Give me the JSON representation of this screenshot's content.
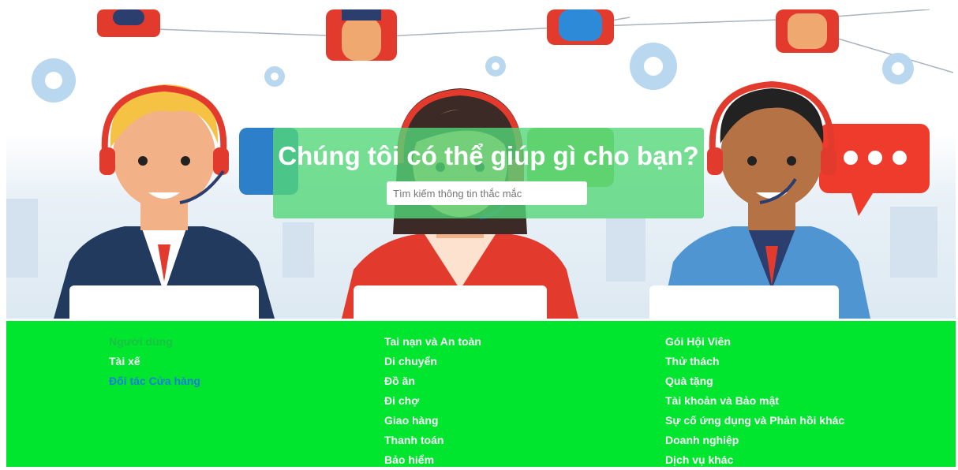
{
  "hero": {
    "title": "Chúng tôi có thể giúp gì cho bạn?",
    "search_placeholder": "Tìm kiếm thông tin thắc mắc"
  },
  "user_types": [
    {
      "label": "Người dùng",
      "color": "#19c240"
    },
    {
      "label": "Tài xế",
      "color": "#ffffff"
    },
    {
      "label": "Đối tác Cửa hàng",
      "color": "#1e7ddc"
    }
  ],
  "topics_col1": [
    "Tai nạn và An toàn",
    "Di chuyển",
    "Đồ ăn",
    "Đi chợ",
    "Giao hàng",
    "Thanh toán",
    "Bảo hiểm"
  ],
  "topics_col2": [
    "Gói Hội Viên",
    "Thử thách",
    "Quà tặng",
    "Tài khoản và Bảo mật",
    "Sự cố ứng dụng và Phản hồi khác",
    "Doanh nghiệp",
    "Dịch vụ khác"
  ],
  "colors": {
    "panel_green": "#00e62f",
    "overlay_green": "#54d778",
    "active_blue": "#1e7ddc"
  }
}
